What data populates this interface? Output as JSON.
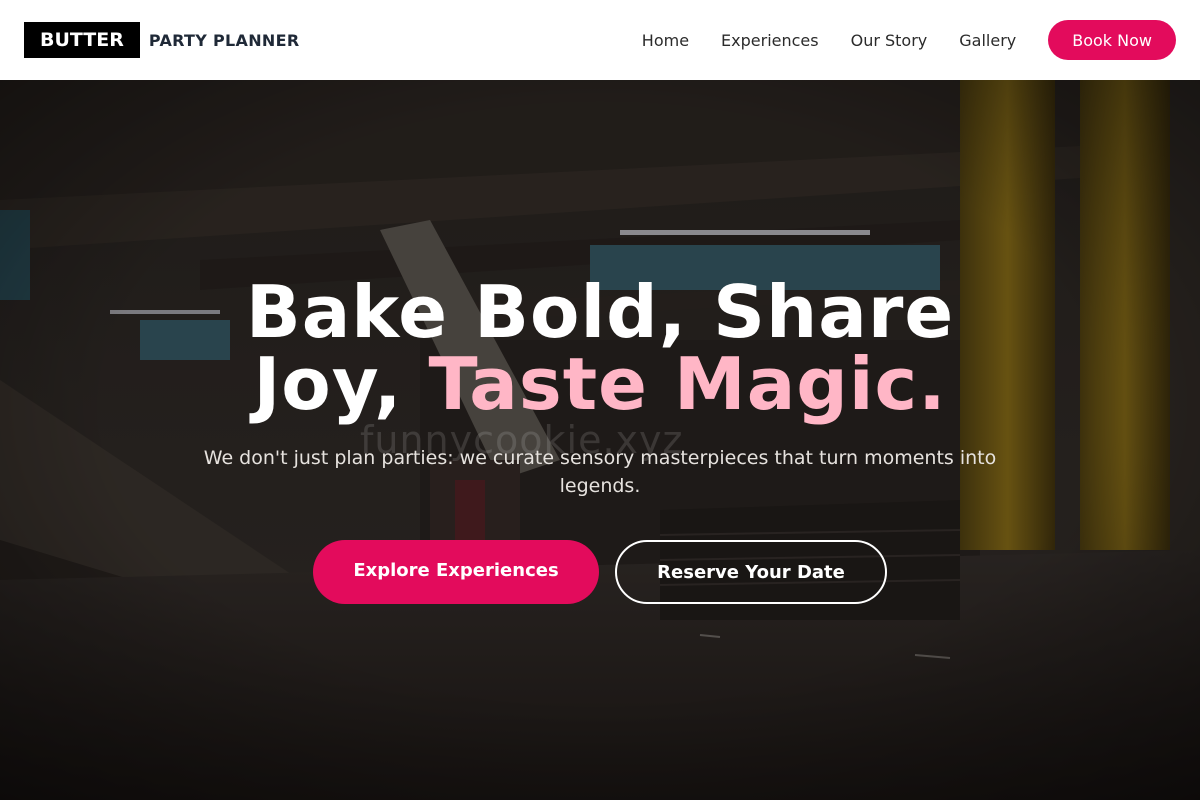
{
  "brand": {
    "logo_label": "BUTTER",
    "tagline": "PARTY PLANNER"
  },
  "nav": {
    "items": [
      {
        "label": "Home"
      },
      {
        "label": "Experiences"
      },
      {
        "label": "Our Story"
      },
      {
        "label": "Gallery"
      }
    ],
    "cta_label": "Book Now"
  },
  "hero": {
    "headline_line1": "Bake Bold, Share",
    "headline_line2_plain": "Joy, ",
    "headline_line2_accent": "Taste Magic.",
    "subtitle": "We don't just plan parties: we curate sensory masterpieces that turn moments into legends.",
    "primary_cta": "Explore Experiences",
    "secondary_cta": "Reserve Your Date",
    "watermark": "funnycookie.xyz",
    "background_description_icon": "parking-garage-photo"
  },
  "colors": {
    "accent": "#e30b5c",
    "headline_accent": "#ffb6c6",
    "header_bg": "#ffffff",
    "logo_bg": "#000000"
  }
}
